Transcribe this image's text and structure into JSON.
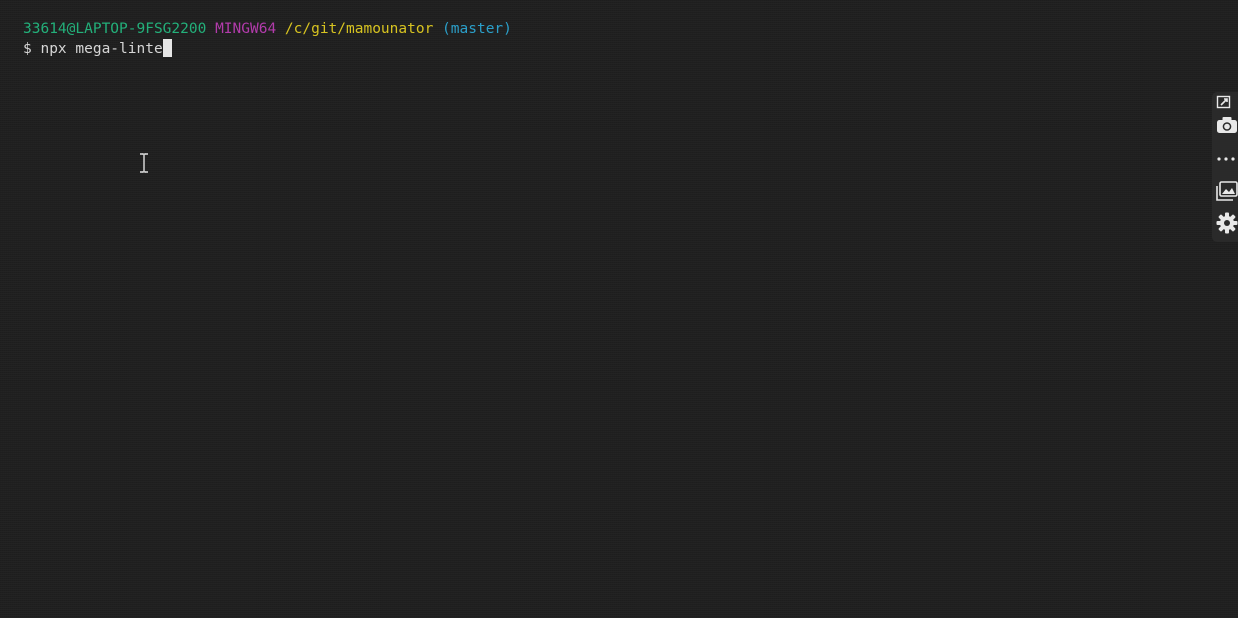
{
  "terminal": {
    "prompt": {
      "user_host": "33614@LAPTOP-9FSG2200",
      "env": "MINGW64",
      "path": "/c/git/mamounator",
      "branch": "(master)"
    },
    "command": {
      "symbol": "$",
      "text": "npx mega-linte"
    }
  },
  "sidebar": {
    "icons": [
      "pin-icon",
      "camera-icon",
      "more-icon",
      "gallery-icon",
      "gear-icon"
    ]
  },
  "colors": {
    "background": "#1f1f1f",
    "user_host": "#23b07a",
    "env": "#b23bab",
    "path": "#d7c321",
    "branch": "#2b9fc9"
  }
}
